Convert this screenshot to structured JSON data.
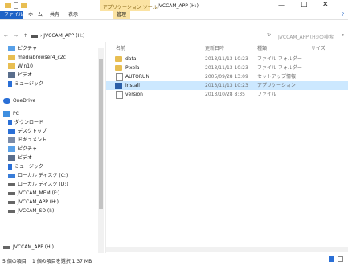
{
  "window": {
    "title": "JVCCAM_APP (H:)",
    "context_tab": "アプリケーション ツール",
    "minimize": "—",
    "maximize": "□",
    "close": "✕"
  },
  "ribbon": {
    "tabs": [
      "ファイル",
      "ホーム",
      "共有",
      "表示",
      "管理"
    ],
    "help_icon": "?"
  },
  "address": {
    "back": "←",
    "forward": "→",
    "up": "↑",
    "path": "› JVCCAM_APP (H:)",
    "refresh": "↻",
    "search_placeholder": "JVCCAM_APP (H:)の検索",
    "search_icon": "⌕"
  },
  "nav": {
    "items": [
      {
        "label": "ピクチャ",
        "icon": "pictures-icon"
      },
      {
        "label": "mediabrowser4_c2c",
        "icon": "folder-icon"
      },
      {
        "label": "Win10",
        "icon": "folder-icon"
      },
      {
        "label": "ビデオ",
        "icon": "videos-icon"
      },
      {
        "label": "ミュージック",
        "icon": "music-icon"
      },
      {
        "label": "OneDrive",
        "icon": "onedrive-icon"
      },
      {
        "label": "PC",
        "icon": "pc-icon"
      },
      {
        "label": "ダウンロード",
        "icon": "downloads-icon"
      },
      {
        "label": "デスクトップ",
        "icon": "desktop-icon"
      },
      {
        "label": "ドキュメント",
        "icon": "documents-icon"
      },
      {
        "label": "ピクチャ",
        "icon": "pictures-icon"
      },
      {
        "label": "ビデオ",
        "icon": "videos-icon"
      },
      {
        "label": "ミュージック",
        "icon": "music-icon"
      },
      {
        "label": "ローカル ディスク (C:)",
        "icon": "drive-icon"
      },
      {
        "label": "ローカル ディスク (D:)",
        "icon": "drive-icon"
      },
      {
        "label": "JVCCAM_MEM (F:)",
        "icon": "drive-icon"
      },
      {
        "label": "JVCCAM_APP (H:)",
        "icon": "drive-icon"
      },
      {
        "label": "JVCCAM_SD (I:)",
        "icon": "drive-icon"
      }
    ],
    "bottom_item": "JVCCAM_APP (H:)"
  },
  "columns": {
    "name": "名前",
    "date": "更新日時",
    "type": "種類",
    "size": "サイズ"
  },
  "files": [
    {
      "name": "data",
      "date": "2013/11/13 10:23",
      "type": "ファイル フォルダー",
      "kind": "folder",
      "selected": false
    },
    {
      "name": "Pixela",
      "date": "2013/11/13 10:23",
      "type": "ファイル フォルダー",
      "kind": "folder",
      "selected": false
    },
    {
      "name": "AUTORUN",
      "date": "2005/09/28 13:09",
      "type": "セットアップ情報",
      "kind": "setup",
      "selected": false
    },
    {
      "name": "install",
      "date": "2013/11/13 10:23",
      "type": "アプリケーション",
      "kind": "app",
      "selected": true
    },
    {
      "name": "version",
      "date": "2013/10/28 8:35",
      "type": "ファイル",
      "kind": "file",
      "selected": false
    }
  ],
  "status": {
    "items": "5 個の項目",
    "selected": "1 個の項目を選択 1.37 MB"
  },
  "colors": {
    "file_tab": "#1f63c6",
    "context_tab_bg": "#fbe3a3",
    "selected_row": "#cce8ff",
    "folder": "#e8be52"
  }
}
